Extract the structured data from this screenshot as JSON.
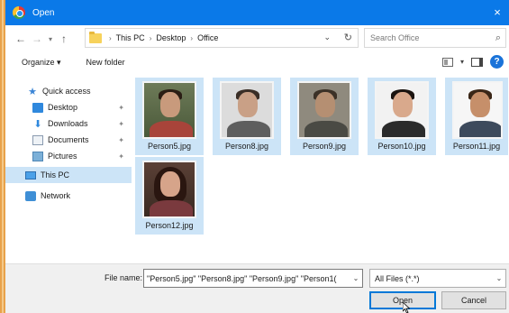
{
  "window": {
    "title": "Open",
    "close_glyph": "×"
  },
  "address": {
    "crumbs": [
      "This PC",
      "Desktop",
      "Office"
    ],
    "search_placeholder": "Search Office"
  },
  "toolbar": {
    "organize_label": "Organize ▾",
    "new_folder_label": "New folder",
    "help_label": "?"
  },
  "nav": {
    "items": [
      {
        "label": "Quick access"
      },
      {
        "label": "Desktop",
        "pinned": true
      },
      {
        "label": "Downloads",
        "pinned": true
      },
      {
        "label": "Documents",
        "pinned": true
      },
      {
        "label": "Pictures",
        "pinned": true
      },
      {
        "label": "This PC",
        "selected": true
      },
      {
        "label": "Network"
      }
    ]
  },
  "files": [
    {
      "name": "Person5.jpg",
      "selected": true
    },
    {
      "name": "Person8.jpg",
      "selected": true
    },
    {
      "name": "Person9.jpg",
      "selected": true
    },
    {
      "name": "Person10.jpg",
      "selected": true
    },
    {
      "name": "Person11.jpg",
      "selected": true
    },
    {
      "name": "Person12.jpg",
      "selected": true
    }
  ],
  "footer": {
    "file_name_label": "File name:",
    "file_name_value": "\"Person5.jpg\" \"Person8.jpg\" \"Person9.jpg\" \"Person1(",
    "file_type_value": "All Files (*.*)",
    "open_label": "Open",
    "cancel_label": "Cancel"
  },
  "colors": {
    "titlebar": "#0a79e8",
    "selection": "#cce4f7",
    "accent": "#0078d7"
  }
}
